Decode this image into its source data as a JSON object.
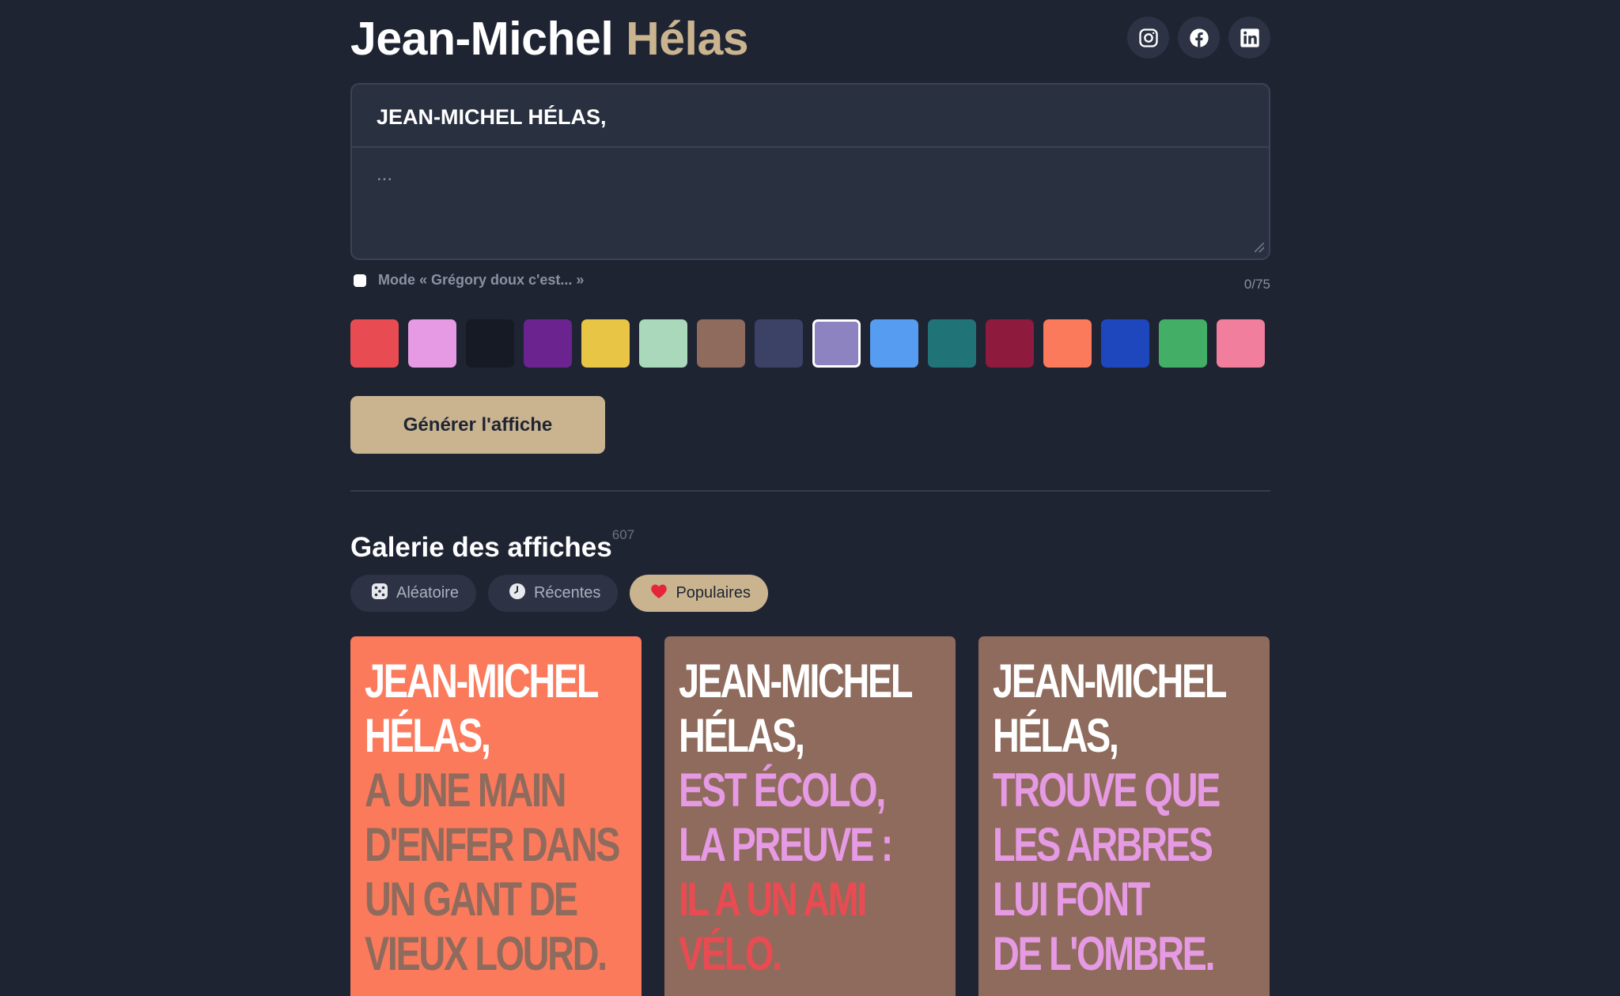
{
  "header": {
    "title_first": "Jean-Michel",
    "title_accent": "Hélas",
    "socials": [
      {
        "name": "instagram-icon"
      },
      {
        "name": "facebook-icon"
      },
      {
        "name": "linkedin-icon"
      }
    ]
  },
  "editor": {
    "prefix": "JEAN-MICHEL HÉLAS,",
    "placeholder": "...",
    "counter": "0/75"
  },
  "mode": {
    "label": "Mode « Grégory doux c'est... »",
    "checked": false
  },
  "swatches": [
    "#e94b52",
    "#e59ae3",
    "#151a24",
    "#6b2390",
    "#e8c545",
    "#a9d8bb",
    "#8e6b5c",
    "#3b4266",
    "#8c83c0",
    "#569cf0",
    "#207477",
    "#8e1a3e",
    "#fb7a5c",
    "#1f47bd",
    "#43ae66",
    "#f17e9d"
  ],
  "selected_swatch": "#8c83c0",
  "generate_label": "Générer l'affiche",
  "gallery": {
    "title": "Galerie des affiches",
    "count": "607",
    "filters": [
      {
        "icon": "dice-icon",
        "label": "Aléatoire",
        "active": false
      },
      {
        "icon": "clock-icon",
        "label": "Récentes",
        "active": false
      },
      {
        "icon": "heart-icon",
        "label": "Populaires",
        "active": true
      }
    ],
    "posters": [
      {
        "bg": "#fb7a5c",
        "lines": [
          {
            "text": "JEAN-MICHEL",
            "color": "#ffffff"
          },
          {
            "text": "HÉLAS,",
            "color": "#ffffff"
          },
          {
            "text": "A UNE MAIN",
            "color": "#8e6b5c"
          },
          {
            "text": "D'ENFER DANS",
            "color": "#8e6b5c"
          },
          {
            "text": "UN GANT DE",
            "color": "#8e6b5c"
          },
          {
            "text": "VIEUX LOURD.",
            "color": "#8e6b5c"
          }
        ]
      },
      {
        "bg": "#8e6b5c",
        "lines": [
          {
            "text": "JEAN-MICHEL",
            "color": "#ffffff"
          },
          {
            "text": "HÉLAS,",
            "color": "#ffffff"
          },
          {
            "text": "EST ÉCOLO,",
            "color": "#e59ae3"
          },
          {
            "text": "LA PREUVE :",
            "color": "#e59ae3"
          },
          {
            "text": "IL A UN AMI",
            "color": "#e94b52"
          },
          {
            "text": "VÉLO.",
            "color": "#e94b52"
          }
        ]
      },
      {
        "bg": "#8e6b5c",
        "lines": [
          {
            "text": "JEAN-MICHEL",
            "color": "#ffffff"
          },
          {
            "text": "HÉLAS,",
            "color": "#ffffff"
          },
          {
            "text": "TROUVE QUE",
            "color": "#e59ae3"
          },
          {
            "text": "LES ARBRES",
            "color": "#e59ae3"
          },
          {
            "text": "LUI FONT",
            "color": "#e59ae3"
          },
          {
            "text": "DE L'OMBRE.",
            "color": "#e59ae3"
          }
        ]
      }
    ]
  }
}
